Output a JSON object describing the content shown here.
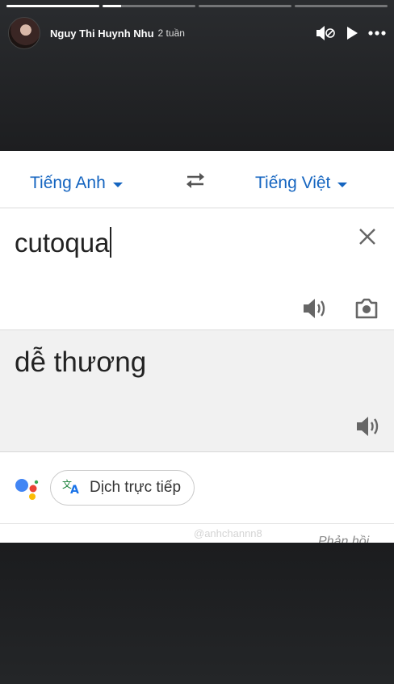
{
  "story": {
    "progress": [
      1,
      0.2,
      0,
      0
    ],
    "user_name": "Nguy Thi Huynh Nhu",
    "time_ago": "2 tuần",
    "icons": [
      "mute-icon",
      "play-icon",
      "more-icon"
    ]
  },
  "translate": {
    "source_lang": "Tiếng Anh",
    "target_lang": "Tiếng Việt",
    "input_text": "cutoqua",
    "output_text": "dễ thương",
    "live_button": "Dịch trực tiếp",
    "watermark": "@anhchannn8",
    "feedback": "Phản hồi",
    "colors": {
      "accent": "#1565c0",
      "output_bg": "#f1f1f1"
    }
  }
}
